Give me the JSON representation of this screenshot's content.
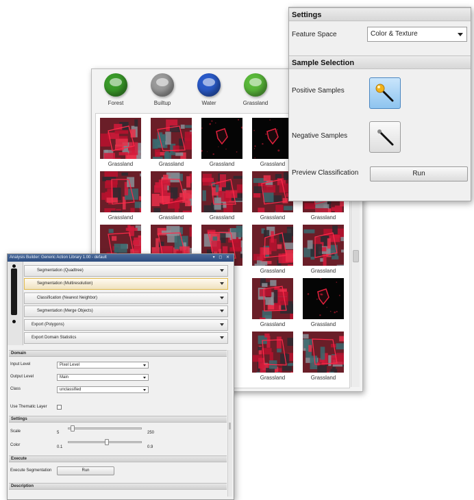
{
  "gallery": {
    "classes": [
      {
        "label": "Forest",
        "color": "#3a9a2a"
      },
      {
        "label": "Builtup",
        "color": "#9a9a9a"
      },
      {
        "label": "Water",
        "color": "#2a5ac8"
      },
      {
        "label": "Grassland",
        "color": "#5ab83a"
      }
    ],
    "thumb_label": "Grassland",
    "visible_labels": [
      "Grassland",
      "Grassland",
      "Grassland",
      "Grassland",
      "Grassland",
      "Grassland",
      "Grassland",
      "Grassland",
      "Grassland",
      "Grassland",
      "Grassland",
      "Grassland",
      "Grassland",
      "Grassland",
      "Grassland"
    ]
  },
  "settings": {
    "header": "Settings",
    "feature_space_label": "Feature Space",
    "feature_space_value": "Color & Texture",
    "sample_selection_header": "Sample Selection",
    "positive_samples_label": "Positive Samples",
    "negative_samples_label": "Negative Samples",
    "preview_label": "Preview Classification",
    "run_label": "Run"
  },
  "builder": {
    "title": "Analysis Builder: Generic Action Library 1.00 - default",
    "actions": [
      "Segmentation (Quadtree)",
      "Segmentation (Multiresolution)",
      "Classification (Nearest Neighbor)",
      "Segmentation (Merge Objects)",
      "Export (Polygons)",
      "Export Domain Statistics"
    ],
    "domain_header": "Domain",
    "input_level_label": "Input Level",
    "input_level_value": "Pixel Level",
    "output_level_label": "Output Level",
    "output_level_value": "Main",
    "class_label": "Class",
    "class_value": "unclassified",
    "thematic_label": "Use Thematic Layer",
    "settings_header": "Settings",
    "scale_label": "Scale",
    "scale_min": "5",
    "scale_max": "250",
    "scale_value": 0.03,
    "color_label": "Color",
    "color_min": "0.1",
    "color_max": "0.9",
    "color_value": 0.52,
    "execute_header": "Execute",
    "execute_label": "Execute Segmentation",
    "execute_run": "Run",
    "description_header": "Description"
  }
}
